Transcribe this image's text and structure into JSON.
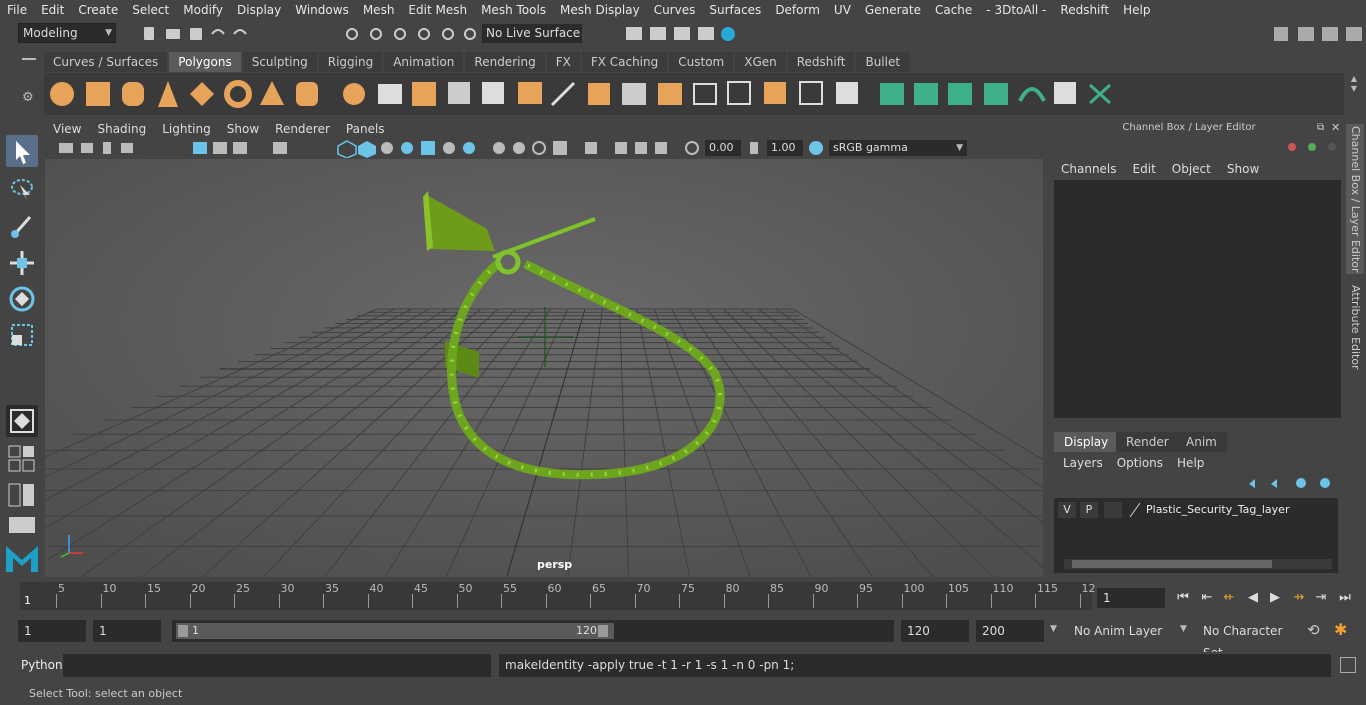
{
  "menubar": {
    "items": [
      "File",
      "Edit",
      "Create",
      "Select",
      "Modify",
      "Display",
      "Windows",
      "Mesh",
      "Edit Mesh",
      "Mesh Tools",
      "Mesh Display",
      "Curves",
      "Surfaces",
      "Deform",
      "UV",
      "Generate",
      "Cache",
      "- 3DtoAll -",
      "Redshift",
      "Help"
    ]
  },
  "status": {
    "mode": "Modeling",
    "live_surface": "No Live Surface"
  },
  "shelf": {
    "tabs": [
      "Curves / Surfaces",
      "Polygons",
      "Sculpting",
      "Rigging",
      "Animation",
      "Rendering",
      "FX",
      "FX Caching",
      "Custom",
      "XGen",
      "Redshift",
      "Bullet"
    ],
    "active_tab": "Polygons"
  },
  "viewport": {
    "menu": [
      "View",
      "Shading",
      "Lighting",
      "Show",
      "Renderer",
      "Panels"
    ],
    "exposure": "0.00",
    "gamma": "1.00",
    "color_space": "sRGB gamma",
    "camera_label": "persp"
  },
  "channel_box": {
    "title": "Channel Box / Layer Editor",
    "menu": [
      "Channels",
      "Edit",
      "Object",
      "Show"
    ],
    "tabs": [
      "Display",
      "Render",
      "Anim"
    ],
    "active_tab": "Display",
    "layer_menu": [
      "Layers",
      "Options",
      "Help"
    ],
    "layer": {
      "v": "V",
      "p": "P",
      "name": "Plastic_Security_Tag_layer"
    }
  },
  "side_tabs": [
    "Channel Box / Layer Editor",
    "Attribute Editor"
  ],
  "timeline": {
    "ticks": [
      "5",
      "10",
      "15",
      "20",
      "25",
      "30",
      "35",
      "40",
      "45",
      "50",
      "55",
      "60",
      "65",
      "70",
      "75",
      "80",
      "85",
      "90",
      "95",
      "100",
      "105",
      "110",
      "115",
      "12"
    ],
    "start_label": "1",
    "current_frame": "1"
  },
  "range": {
    "start": "1",
    "start2": "1",
    "slider_start": "1",
    "slider_end": "120",
    "end": "120",
    "end2": "200",
    "anim_layer": "No Anim Layer",
    "char_set": "No Character Set"
  },
  "command": {
    "lang": "Python",
    "output": "makeIdentity -apply true -t 1 -r 1 -s 1 -n 0 -pn 1;"
  },
  "help_line": "Select Tool: select an object",
  "colors": {
    "accent_green": "#7fc22b",
    "shelf_orange": "#e8a35a",
    "shelf_teal": "#3fb08a"
  }
}
